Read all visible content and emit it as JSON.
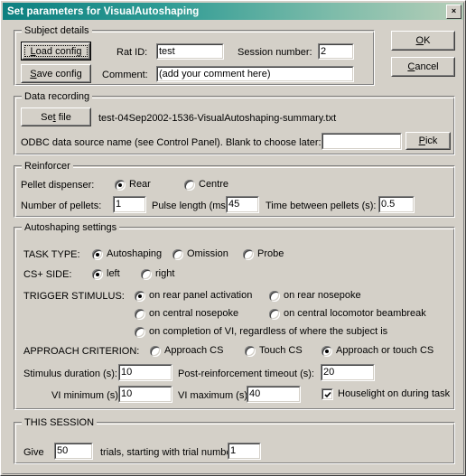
{
  "window": {
    "title": "Set parameters for VisualAutoshaping",
    "close_label": "×",
    "titlebar_color_start": "#0d8080",
    "titlebar_color_end": "#b6ceb8",
    "face_color": "#d4d0c8"
  },
  "actions": {
    "ok": {
      "label": "OK",
      "accel": "O"
    },
    "cancel": {
      "label": "Cancel",
      "accel": "C"
    }
  },
  "subject_details": {
    "title": "Subject details",
    "load_config": {
      "label": "Load config",
      "accel": "L"
    },
    "save_config": {
      "label": "Save config",
      "accel": "S"
    },
    "rat_id": {
      "label": "Rat ID:",
      "value": "test"
    },
    "session_number": {
      "label": "Session number:",
      "value": "2"
    },
    "comment": {
      "label": "Comment:",
      "value": "(add your comment here)"
    }
  },
  "data_recording": {
    "title": "Data recording",
    "set_file": {
      "label": "Set file",
      "accel": "t"
    },
    "filename": "test-04Sep2002-1536-VisualAutoshaping-summary.txt",
    "odbc_label": "ODBC data source name (see Control Panel). Blank to choose later:",
    "odbc_value": "",
    "pick": {
      "label": "Pick",
      "accel": "P"
    }
  },
  "reinforcer": {
    "title": "Reinforcer",
    "pellet_dispenser_label": "Pellet dispenser:",
    "pellet_dispenser_options": [
      {
        "label": "Rear",
        "checked": true
      },
      {
        "label": "Centre",
        "checked": false
      }
    ],
    "number_of_pellets": {
      "label": "Number of pellets:",
      "value": "1"
    },
    "pulse_length": {
      "label": "Pulse length (ms):",
      "value": "45"
    },
    "time_between_pellets": {
      "label": "Time between pellets (s):",
      "value": "0.5"
    }
  },
  "autoshaping_settings": {
    "title": "Autoshaping settings",
    "task_type_label": "TASK TYPE:",
    "task_type_options": [
      {
        "label": "Autoshaping",
        "checked": true
      },
      {
        "label": "Omission",
        "checked": false
      },
      {
        "label": "Probe",
        "checked": false
      }
    ],
    "cs_side_label": "CS+ SIDE:",
    "cs_side_options": [
      {
        "label": "left",
        "checked": true
      },
      {
        "label": "right",
        "checked": false
      }
    ],
    "trigger_stimulus_label": "TRIGGER STIMULUS:",
    "trigger_stimulus_options": [
      {
        "label": "on rear panel activation",
        "checked": true
      },
      {
        "label": "on rear nosepoke",
        "checked": false
      },
      {
        "label": "on central nosepoke",
        "checked": false
      },
      {
        "label": "on central locomotor beambreak",
        "checked": false
      },
      {
        "label": "on completion of VI, regardless of where the subject is",
        "checked": false
      }
    ],
    "approach_criterion_label": "APPROACH CRITERION:",
    "approach_criterion_options": [
      {
        "label": "Approach CS",
        "checked": false
      },
      {
        "label": "Touch CS",
        "checked": false
      },
      {
        "label": "Approach or touch CS",
        "checked": true
      }
    ],
    "stimulus_duration": {
      "label": "Stimulus duration (s):",
      "value": "10"
    },
    "post_reinforcement_timeout": {
      "label": "Post-reinforcement timeout (s):",
      "value": "20"
    },
    "vi_minimum": {
      "label": "VI minimum (s):",
      "value": "10"
    },
    "vi_maximum": {
      "label": "VI maximum (s):",
      "value": "40"
    },
    "houselight": {
      "label": "Houselight on during task",
      "checked": true
    }
  },
  "this_session": {
    "title": "THIS SESSION",
    "give_label": "Give",
    "trials_value": "50",
    "trials_label": "trials, starting with trial number",
    "start_trial_value": "1"
  }
}
